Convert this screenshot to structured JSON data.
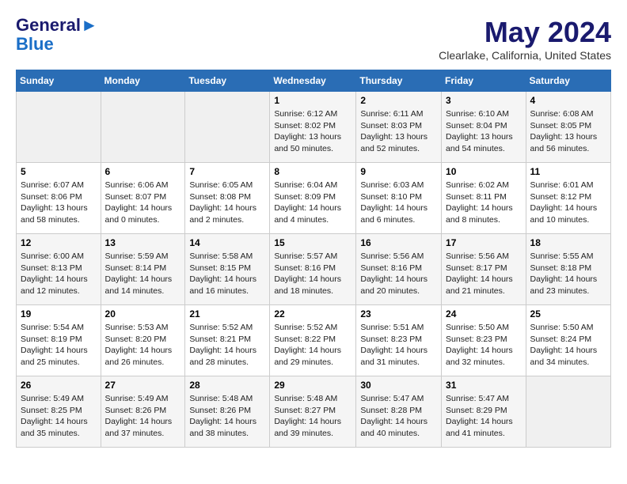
{
  "header": {
    "logo_line1": "General",
    "logo_line2": "Blue",
    "month": "May 2024",
    "location": "Clearlake, California, United States"
  },
  "weekdays": [
    "Sunday",
    "Monday",
    "Tuesday",
    "Wednesday",
    "Thursday",
    "Friday",
    "Saturday"
  ],
  "weeks": [
    [
      {
        "num": "",
        "info": ""
      },
      {
        "num": "",
        "info": ""
      },
      {
        "num": "",
        "info": ""
      },
      {
        "num": "1",
        "info": "Sunrise: 6:12 AM\nSunset: 8:02 PM\nDaylight: 13 hours\nand 50 minutes."
      },
      {
        "num": "2",
        "info": "Sunrise: 6:11 AM\nSunset: 8:03 PM\nDaylight: 13 hours\nand 52 minutes."
      },
      {
        "num": "3",
        "info": "Sunrise: 6:10 AM\nSunset: 8:04 PM\nDaylight: 13 hours\nand 54 minutes."
      },
      {
        "num": "4",
        "info": "Sunrise: 6:08 AM\nSunset: 8:05 PM\nDaylight: 13 hours\nand 56 minutes."
      }
    ],
    [
      {
        "num": "5",
        "info": "Sunrise: 6:07 AM\nSunset: 8:06 PM\nDaylight: 13 hours\nand 58 minutes."
      },
      {
        "num": "6",
        "info": "Sunrise: 6:06 AM\nSunset: 8:07 PM\nDaylight: 14 hours\nand 0 minutes."
      },
      {
        "num": "7",
        "info": "Sunrise: 6:05 AM\nSunset: 8:08 PM\nDaylight: 14 hours\nand 2 minutes."
      },
      {
        "num": "8",
        "info": "Sunrise: 6:04 AM\nSunset: 8:09 PM\nDaylight: 14 hours\nand 4 minutes."
      },
      {
        "num": "9",
        "info": "Sunrise: 6:03 AM\nSunset: 8:10 PM\nDaylight: 14 hours\nand 6 minutes."
      },
      {
        "num": "10",
        "info": "Sunrise: 6:02 AM\nSunset: 8:11 PM\nDaylight: 14 hours\nand 8 minutes."
      },
      {
        "num": "11",
        "info": "Sunrise: 6:01 AM\nSunset: 8:12 PM\nDaylight: 14 hours\nand 10 minutes."
      }
    ],
    [
      {
        "num": "12",
        "info": "Sunrise: 6:00 AM\nSunset: 8:13 PM\nDaylight: 14 hours\nand 12 minutes."
      },
      {
        "num": "13",
        "info": "Sunrise: 5:59 AM\nSunset: 8:14 PM\nDaylight: 14 hours\nand 14 minutes."
      },
      {
        "num": "14",
        "info": "Sunrise: 5:58 AM\nSunset: 8:15 PM\nDaylight: 14 hours\nand 16 minutes."
      },
      {
        "num": "15",
        "info": "Sunrise: 5:57 AM\nSunset: 8:16 PM\nDaylight: 14 hours\nand 18 minutes."
      },
      {
        "num": "16",
        "info": "Sunrise: 5:56 AM\nSunset: 8:16 PM\nDaylight: 14 hours\nand 20 minutes."
      },
      {
        "num": "17",
        "info": "Sunrise: 5:56 AM\nSunset: 8:17 PM\nDaylight: 14 hours\nand 21 minutes."
      },
      {
        "num": "18",
        "info": "Sunrise: 5:55 AM\nSunset: 8:18 PM\nDaylight: 14 hours\nand 23 minutes."
      }
    ],
    [
      {
        "num": "19",
        "info": "Sunrise: 5:54 AM\nSunset: 8:19 PM\nDaylight: 14 hours\nand 25 minutes."
      },
      {
        "num": "20",
        "info": "Sunrise: 5:53 AM\nSunset: 8:20 PM\nDaylight: 14 hours\nand 26 minutes."
      },
      {
        "num": "21",
        "info": "Sunrise: 5:52 AM\nSunset: 8:21 PM\nDaylight: 14 hours\nand 28 minutes."
      },
      {
        "num": "22",
        "info": "Sunrise: 5:52 AM\nSunset: 8:22 PM\nDaylight: 14 hours\nand 29 minutes."
      },
      {
        "num": "23",
        "info": "Sunrise: 5:51 AM\nSunset: 8:23 PM\nDaylight: 14 hours\nand 31 minutes."
      },
      {
        "num": "24",
        "info": "Sunrise: 5:50 AM\nSunset: 8:23 PM\nDaylight: 14 hours\nand 32 minutes."
      },
      {
        "num": "25",
        "info": "Sunrise: 5:50 AM\nSunset: 8:24 PM\nDaylight: 14 hours\nand 34 minutes."
      }
    ],
    [
      {
        "num": "26",
        "info": "Sunrise: 5:49 AM\nSunset: 8:25 PM\nDaylight: 14 hours\nand 35 minutes."
      },
      {
        "num": "27",
        "info": "Sunrise: 5:49 AM\nSunset: 8:26 PM\nDaylight: 14 hours\nand 37 minutes."
      },
      {
        "num": "28",
        "info": "Sunrise: 5:48 AM\nSunset: 8:26 PM\nDaylight: 14 hours\nand 38 minutes."
      },
      {
        "num": "29",
        "info": "Sunrise: 5:48 AM\nSunset: 8:27 PM\nDaylight: 14 hours\nand 39 minutes."
      },
      {
        "num": "30",
        "info": "Sunrise: 5:47 AM\nSunset: 8:28 PM\nDaylight: 14 hours\nand 40 minutes."
      },
      {
        "num": "31",
        "info": "Sunrise: 5:47 AM\nSunset: 8:29 PM\nDaylight: 14 hours\nand 41 minutes."
      },
      {
        "num": "",
        "info": ""
      }
    ]
  ]
}
